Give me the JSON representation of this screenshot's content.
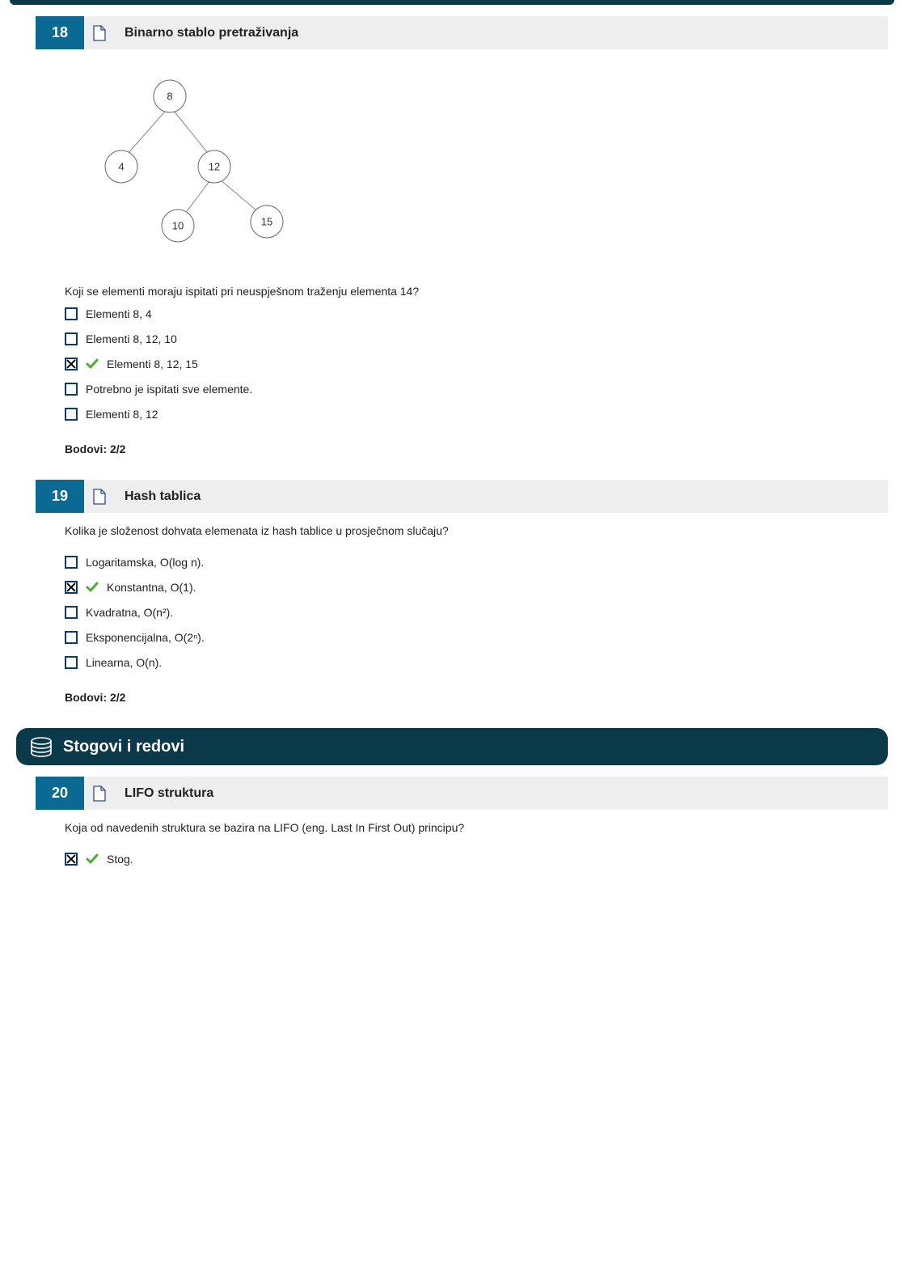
{
  "q18": {
    "num": "18",
    "title": "Binarno stablo pretraživanja",
    "tree": {
      "root": "8",
      "left": "4",
      "right": "12",
      "rleft": "10",
      "rright": "15"
    },
    "subq": "Koji se elementi moraju ispitati pri neuspješnom traženju elementa 14?",
    "options": [
      {
        "txt": "Elementi 8, 4",
        "checked": false,
        "correct": false
      },
      {
        "txt": "Elementi 8, 12, 10",
        "checked": false,
        "correct": false
      },
      {
        "txt": "Elementi 8, 12, 15",
        "checked": true,
        "correct": true
      },
      {
        "txt": "Potrebno je ispitati sve elemente.",
        "checked": false,
        "correct": false
      },
      {
        "txt": "Elementi 8, 12",
        "checked": false,
        "correct": false
      }
    ],
    "points": "Bodovi: 2/2"
  },
  "q19": {
    "num": "19",
    "title": "Hash tablica",
    "stem": "Kolika je složenost dohvata elemenata iz hash tablice u prosječnom slučaju?",
    "options": [
      {
        "txt": "Logaritamska, O(log n).",
        "checked": false,
        "correct": false
      },
      {
        "txt": "Konstantna, O(1).",
        "checked": true,
        "correct": true
      },
      {
        "txt": "Kvadratna, O(n²).",
        "checked": false,
        "correct": false
      },
      {
        "txt": "Eksponencijalna, O(2ⁿ).",
        "checked": false,
        "correct": false
      },
      {
        "txt": "Linearna, O(n).",
        "checked": false,
        "correct": false
      }
    ],
    "points": "Bodovi: 2/2"
  },
  "section": {
    "title": "Stogovi i redovi"
  },
  "q20": {
    "num": "20",
    "title": "LIFO struktura",
    "stem": "Koja od navedenih struktura se bazira na LIFO (eng. Last In First Out) principu?",
    "options": [
      {
        "txt": "Stog.",
        "checked": true,
        "correct": true
      }
    ]
  }
}
